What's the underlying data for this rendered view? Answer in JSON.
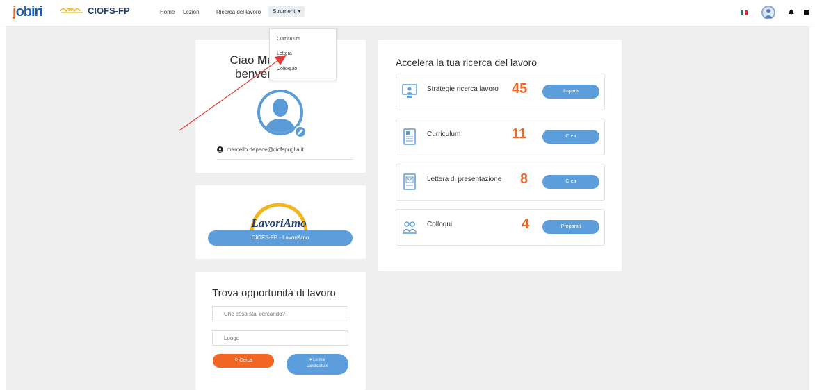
{
  "brand": {
    "jobiri": "jobiri",
    "ciofs": "CIOFS-FP"
  },
  "nav": {
    "home": "Home",
    "lezioni": "Lezioni",
    "ricerca": "Ricerca del lavoro",
    "strumenti": "Strumenti ▾"
  },
  "dropdown": {
    "items": [
      "Curriculum",
      "Lettera",
      "Colloquio"
    ]
  },
  "profile": {
    "greeting_pre": "Ciao ",
    "name_visible_start": "Mar",
    "name_visible_end": "e",
    "greeting_comma": ",",
    "welcome_start": "benvenu",
    "welcome_end": "i",
    "email": "marcello.depace@ciofspuglia.it"
  },
  "lavoriamo": {
    "logo_text": "LavoriAmo",
    "button": "CIOFS-FP - LavoriAmo"
  },
  "search": {
    "title": "Trova opportunità di lavoro",
    "what_placeholder": "Che cosa stai cercando?",
    "where_placeholder": "Luogo",
    "search_button": "Cerca",
    "applications_line1": "Le mie",
    "applications_line2": "candidature"
  },
  "accelerate": {
    "title": "Accelera la tua ricerca del lavoro",
    "features": [
      {
        "label": "Strategie ricerca lavoro",
        "count": "45",
        "button": "Impara"
      },
      {
        "label": "Curriculum",
        "count": "11",
        "button": "Crea"
      },
      {
        "label": "Lettera di presentazione",
        "count": "8",
        "button": "Crea"
      },
      {
        "label": "Colloqui",
        "count": "4",
        "button": "Preparati"
      }
    ]
  },
  "colors": {
    "accent_blue": "#5b9edb",
    "accent_orange": "#f26522",
    "annotation_red": "#e53935"
  }
}
